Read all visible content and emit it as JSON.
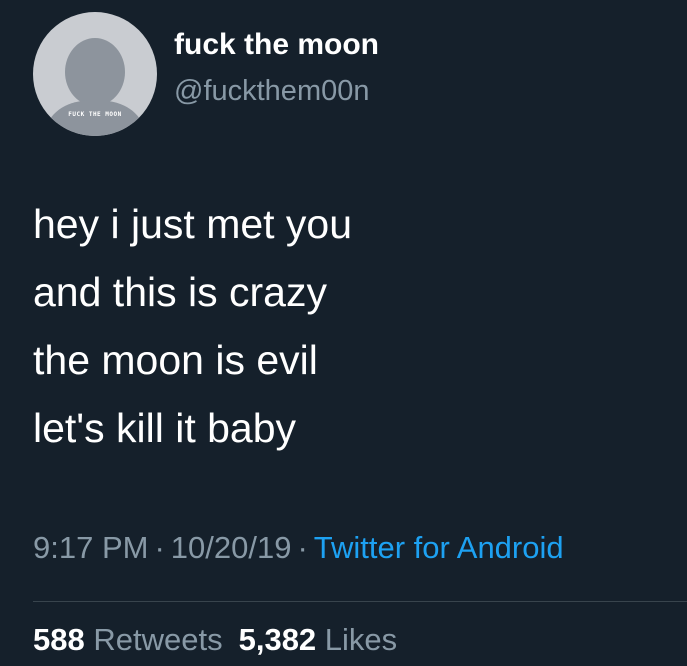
{
  "user": {
    "display_name": "fuck the moon",
    "handle": "@fuckthem00n",
    "avatar_caption": "FUCK THE MOON"
  },
  "tweet": {
    "lines": [
      "hey i just met you",
      "and this is crazy",
      "the moon is evil",
      "let's kill it baby"
    ],
    "time": "9:17 PM",
    "date": "10/20/19",
    "source": "Twitter for Android",
    "separator": "·"
  },
  "stats": {
    "retweets_count": "588",
    "retweets_label": "Retweets",
    "likes_count": "5,382",
    "likes_label": "Likes"
  },
  "colors": {
    "background": "#15202b",
    "primary_text": "#ffffff",
    "secondary_text": "#8899a6",
    "link": "#1da1f2",
    "divider": "#38444d"
  }
}
